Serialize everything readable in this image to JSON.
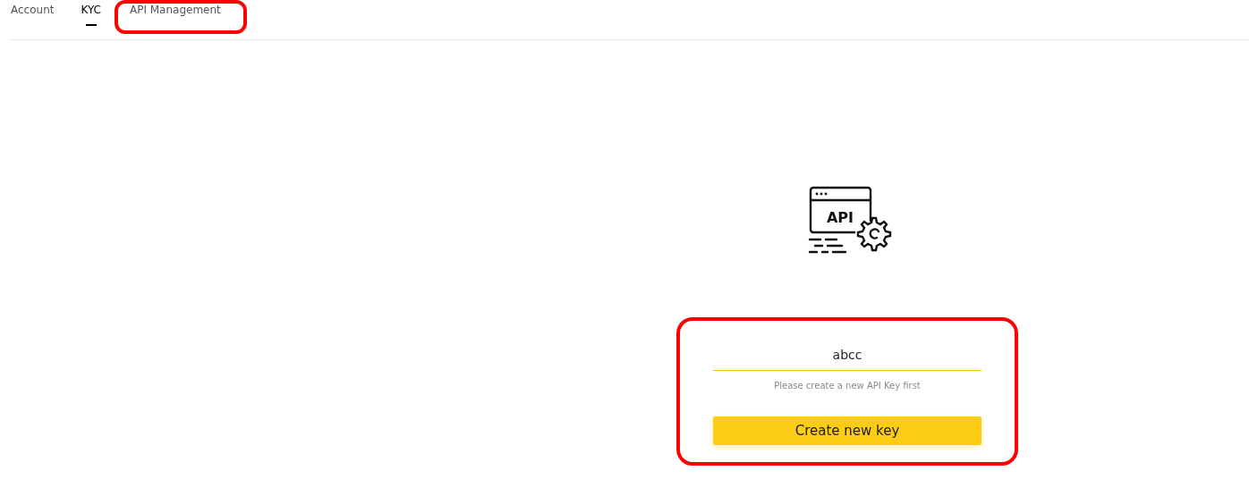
{
  "tabs": [
    {
      "label": "Account",
      "selected": false,
      "highlighted": false
    },
    {
      "label": "KYC",
      "selected": true,
      "highlighted": false
    },
    {
      "label": "API Management",
      "selected": false,
      "highlighted": true
    }
  ],
  "empty_state": {
    "icon_label": "API"
  },
  "key_form": {
    "highlighted": true,
    "value": "abcc",
    "hint": "Please create a new API Key first",
    "button": "Create new key"
  }
}
